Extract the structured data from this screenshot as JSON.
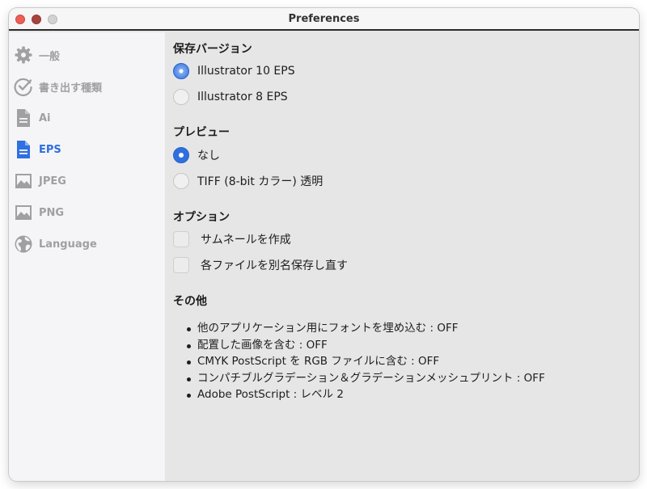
{
  "window": {
    "title": "Preferences"
  },
  "sidebar": {
    "items": [
      {
        "label": "一般",
        "icon": "gear-icon"
      },
      {
        "label": "書き出す種類",
        "icon": "checkmark-circle-icon"
      },
      {
        "label": "Ai",
        "icon": "document-icon"
      },
      {
        "label": "EPS",
        "icon": "document-icon",
        "selected": true
      },
      {
        "label": "JPEG",
        "icon": "image-icon"
      },
      {
        "label": "PNG",
        "icon": "image-icon"
      },
      {
        "label": "Language",
        "icon": "globe-icon"
      }
    ]
  },
  "main": {
    "version": {
      "title": "保存バージョン",
      "options": [
        {
          "label": "Illustrator 10 EPS",
          "selected": true
        },
        {
          "label": "Illustrator 8 EPS",
          "selected": false
        }
      ]
    },
    "preview": {
      "title": "プレビュー",
      "options": [
        {
          "label": "なし",
          "selected": true
        },
        {
          "label": "TIFF (8-bit カラー) 透明",
          "selected": false
        }
      ]
    },
    "options": {
      "title": "オプション",
      "checkboxes": [
        {
          "label": "サムネールを作成",
          "checked": false
        },
        {
          "label": "各ファイルを別名保存し直す",
          "checked": false
        }
      ]
    },
    "other": {
      "title": "その他",
      "items": [
        "他のアプリケーション用にフォントを埋め込む : OFF",
        "配置した画像を含む : OFF",
        "CMYK PostScript を RGB ファイルに含む : OFF",
        "コンパチブルグラデーション＆グラデーションメッシュプリント : OFF",
        "Adobe PostScript : レベル 2"
      ]
    }
  },
  "colors": {
    "accent": "#2f6fe0",
    "sidebar_bg": "#f5f5f7",
    "content_bg": "#e6e6e6"
  }
}
